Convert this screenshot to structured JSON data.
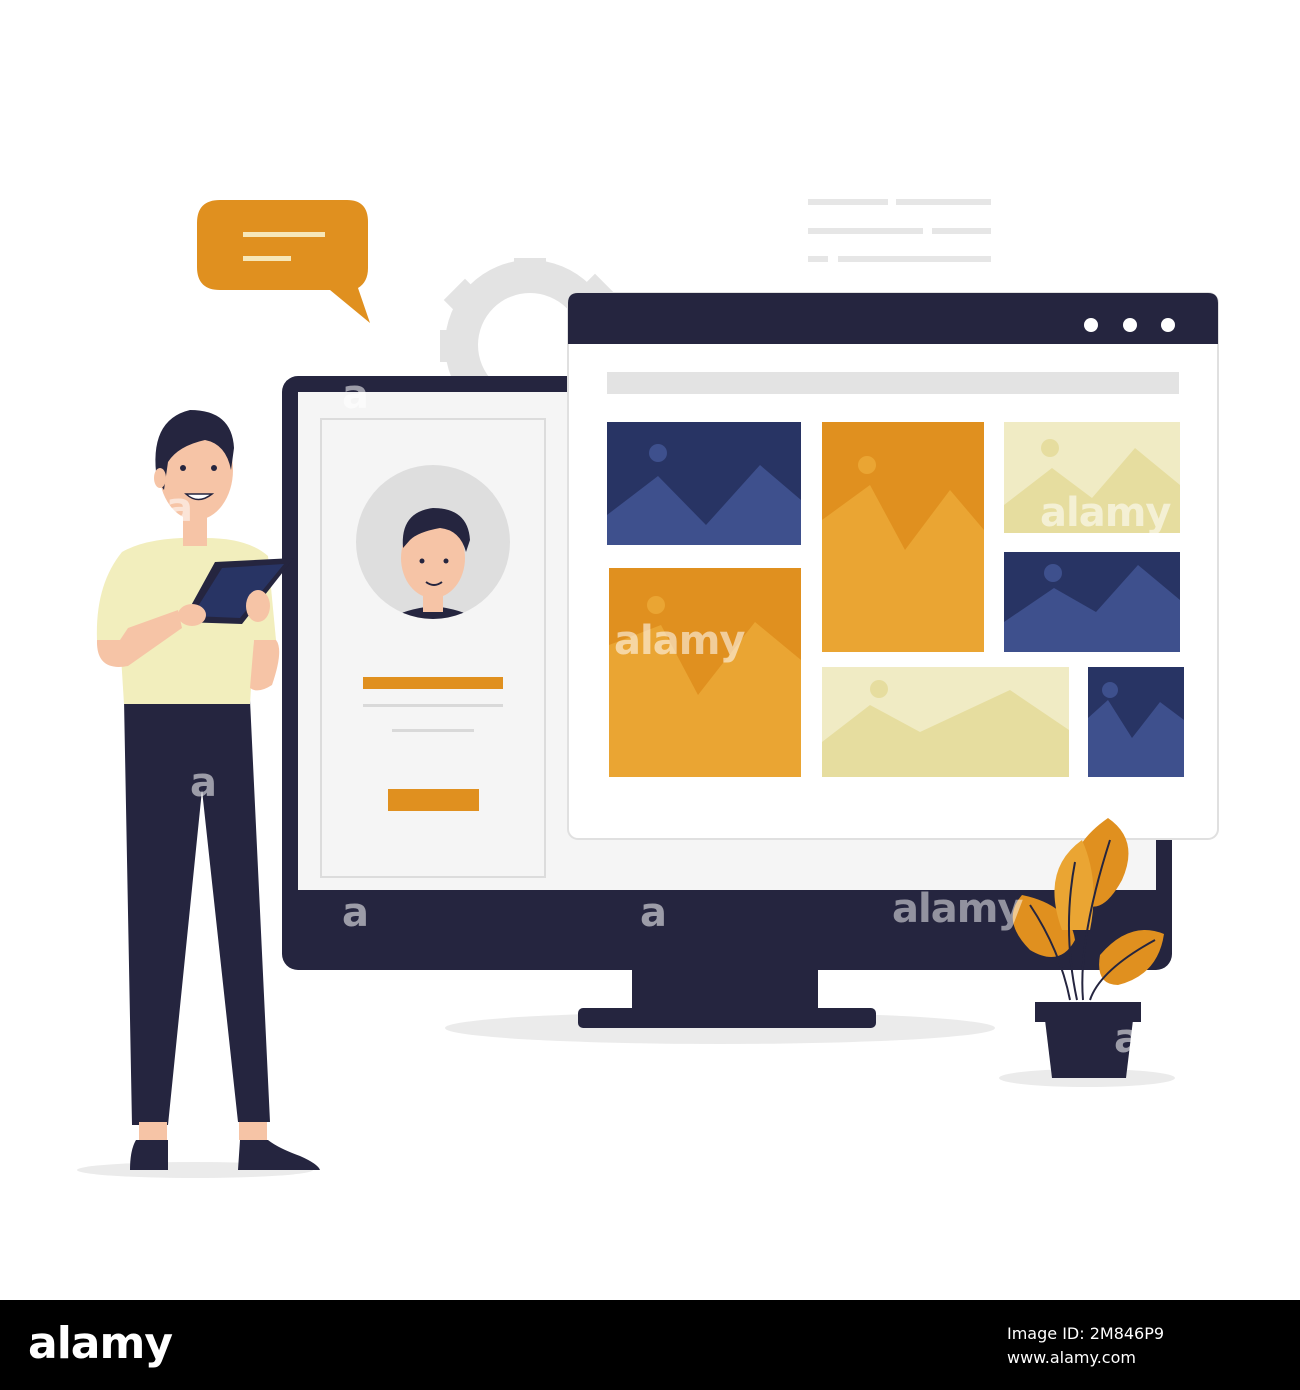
{
  "watermark": {
    "mark": "a",
    "word": "alamy"
  },
  "footer": {
    "brand": "alamy",
    "image_id": "Image ID: 2M846P9",
    "url": "www.alamy.com"
  },
  "colors": {
    "navy": "#25253f",
    "blue": "#3e508d",
    "deep_blue": "#283464",
    "orange": "#e0901f",
    "amber": "#eaa533",
    "sand": "#e6dd9f",
    "pale": "#f0ebc4",
    "gray": "#e3e3e3"
  }
}
